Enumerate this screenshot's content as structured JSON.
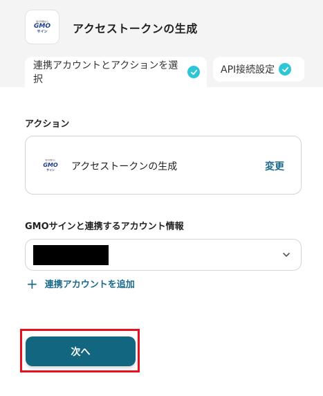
{
  "header": {
    "title": "アクセストークンの生成",
    "logo": {
      "tagline": "電子印鑑なら",
      "brand": "GMO",
      "product": "サイン"
    }
  },
  "tabs": [
    {
      "label": "連携アカウントとアクションを選択",
      "completed": true,
      "active": true
    },
    {
      "label": "API接続設定",
      "completed": true,
      "active": false
    }
  ],
  "action_section": {
    "label": "アクション",
    "action_name": "アクセストークンの生成",
    "change_label": "変更"
  },
  "account_section": {
    "label": "GMOサインと連携するアカウント情報",
    "selected_account": "",
    "add_account_label": "連携アカウントを追加"
  },
  "footer": {
    "next_label": "次へ"
  },
  "colors": {
    "accent": "#13667f",
    "check": "#2cc6d6",
    "highlight": "#e8101e"
  }
}
